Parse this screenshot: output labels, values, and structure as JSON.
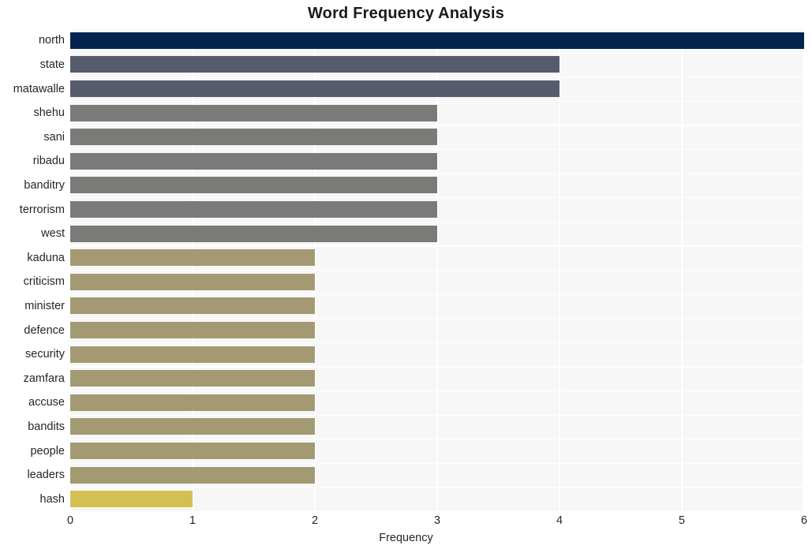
{
  "chart_data": {
    "type": "bar",
    "orientation": "horizontal",
    "title": "Word Frequency Analysis",
    "xlabel": "Frequency",
    "ylabel": "",
    "xlim": [
      0,
      6
    ],
    "xticks": [
      0,
      1,
      2,
      3,
      4,
      5,
      6
    ],
    "xtick_labels": [
      "0",
      "1",
      "2",
      "3",
      "4",
      "5",
      "6"
    ],
    "grid": true,
    "grid_axis": "x",
    "legend": false,
    "categories": [
      "north",
      "state",
      "matawalle",
      "shehu",
      "sani",
      "ribadu",
      "banditry",
      "terrorism",
      "west",
      "kaduna",
      "criticism",
      "minister",
      "defence",
      "security",
      "zamfara",
      "accuse",
      "bandits",
      "people",
      "leaders",
      "hash"
    ],
    "values": [
      6,
      4,
      4,
      3,
      3,
      3,
      3,
      3,
      3,
      2,
      2,
      2,
      2,
      2,
      2,
      2,
      2,
      2,
      2,
      1
    ],
    "bar_colors": [
      "#04244f",
      "#565b6e",
      "#565b6e",
      "#7a7a78",
      "#7a7a78",
      "#7a7a78",
      "#7a7a78",
      "#7a7a78",
      "#7a7a78",
      "#a39a74",
      "#a39a74",
      "#a39a74",
      "#a39a74",
      "#a39a74",
      "#a39a74",
      "#a39a74",
      "#a39a74",
      "#a39a74",
      "#a39a74",
      "#d4c052"
    ],
    "plot_background": "#f7f7f7",
    "grid_color": "#ffffff",
    "figure_background": "#ffffff",
    "text_color": "#262626"
  }
}
